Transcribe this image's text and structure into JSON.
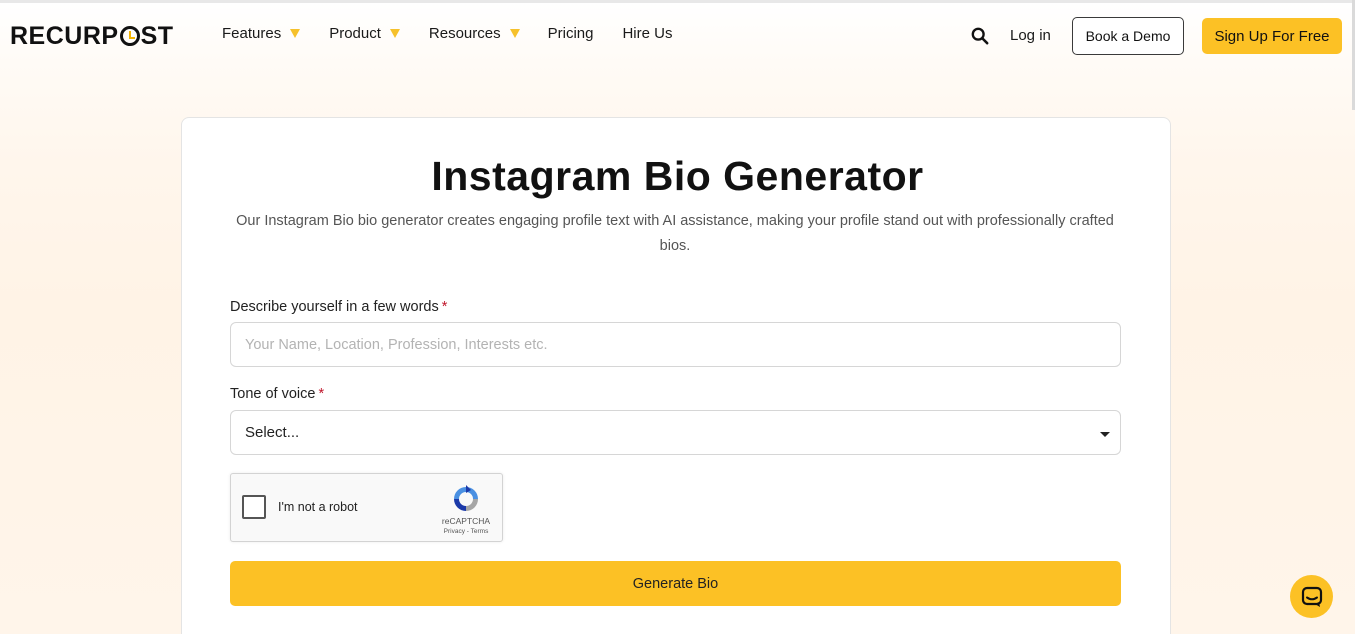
{
  "header": {
    "logo_text_left": "RECURP",
    "logo_text_right": "ST",
    "logo_accent": "#f4b400",
    "nav": [
      {
        "label": "Features",
        "has_dropdown": true
      },
      {
        "label": "Product",
        "has_dropdown": true
      },
      {
        "label": "Resources",
        "has_dropdown": true
      },
      {
        "label": "Pricing",
        "has_dropdown": false
      },
      {
        "label": "Hire Us",
        "has_dropdown": false
      }
    ],
    "search_icon": "search-icon",
    "login_label": "Log in",
    "demo_label": "Book a Demo",
    "signup_label": "Sign Up For Free"
  },
  "main": {
    "title": "Instagram Bio Generator",
    "subtitle": "Our Instagram Bio bio generator creates engaging profile text with AI assistance, making your profile stand out with professionally crafted bios.",
    "describe_label": "Describe yourself in a few words",
    "required_mark": "*",
    "describe_placeholder": "Your Name, Location, Profession, Interests etc.",
    "describe_value": "",
    "tone_label": "Tone of voice",
    "tone_selected": "Select...",
    "captcha": {
      "text": "I'm not a robot",
      "brand": "reCAPTCHA",
      "links": "Privacy - Terms"
    },
    "generate_label": "Generate Bio"
  },
  "colors": {
    "accent_yellow": "#fcc125",
    "required_red": "#c0162b"
  },
  "chat_icon": "chat-bubble-icon"
}
